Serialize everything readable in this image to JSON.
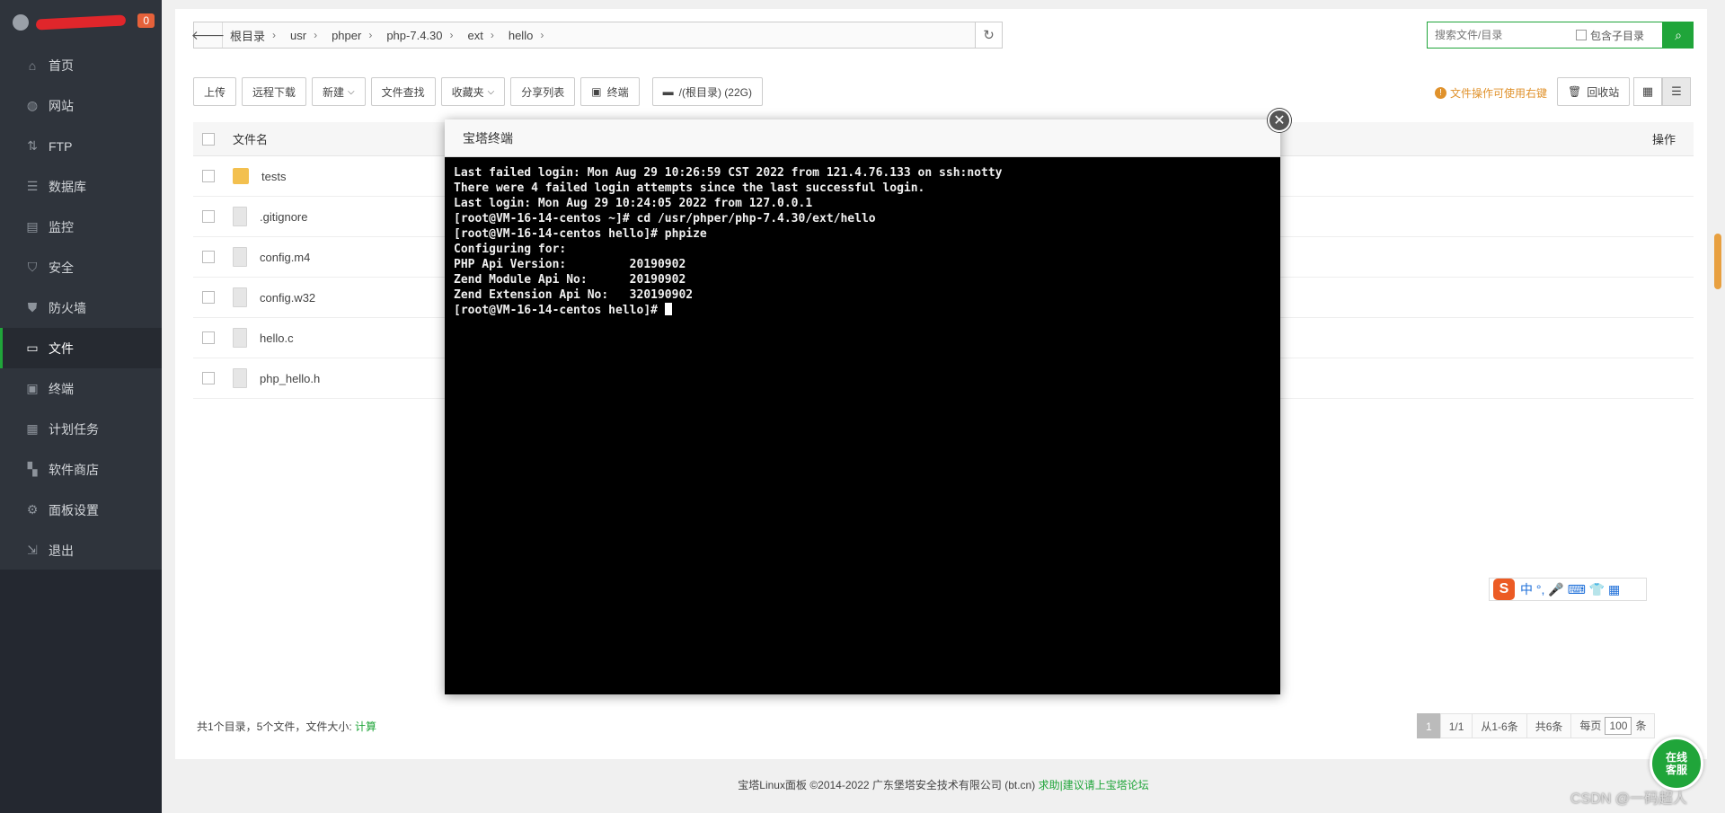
{
  "sidebar": {
    "badge": "0",
    "items": [
      {
        "label": "首页",
        "icon": "home-icon"
      },
      {
        "label": "网站",
        "icon": "globe-icon"
      },
      {
        "label": "FTP",
        "icon": "ftp-icon"
      },
      {
        "label": "数据库",
        "icon": "database-icon"
      },
      {
        "label": "监控",
        "icon": "monitor-icon"
      },
      {
        "label": "安全",
        "icon": "shield-icon"
      },
      {
        "label": "防火墙",
        "icon": "firewall-icon"
      },
      {
        "label": "文件",
        "icon": "folder-icon"
      },
      {
        "label": "终端",
        "icon": "terminal-icon"
      },
      {
        "label": "计划任务",
        "icon": "calendar-icon"
      },
      {
        "label": "软件商店",
        "icon": "apps-icon"
      },
      {
        "label": "面板设置",
        "icon": "gear-icon"
      },
      {
        "label": "退出",
        "icon": "logout-icon"
      }
    ],
    "active_index": 7
  },
  "path": {
    "crumbs": [
      "根目录",
      "usr",
      "phper",
      "php-7.4.30",
      "ext",
      "hello"
    ]
  },
  "search": {
    "placeholder": "搜索文件/目录",
    "include_subdir": "包含子目录"
  },
  "toolbar": {
    "upload": "上传",
    "remote_download": "远程下载",
    "new": "新建",
    "file_search": "文件查找",
    "favorites": "收藏夹",
    "share_list": "分享列表",
    "terminal": "终端",
    "disk": "/(根目录) (22G)"
  },
  "tip": "文件操作可使用右键",
  "recycle": "回收站",
  "table": {
    "col_name": "文件名",
    "col_op": "操作",
    "rows": [
      {
        "name": "tests",
        "type": "folder"
      },
      {
        "name": ".gitignore",
        "type": "file"
      },
      {
        "name": "config.m4",
        "type": "file"
      },
      {
        "name": "config.w32",
        "type": "file"
      },
      {
        "name": "hello.c",
        "type": "file"
      },
      {
        "name": "php_hello.h",
        "type": "file"
      }
    ]
  },
  "summary": {
    "text": "共1个目录，5个文件，文件大小:",
    "link": "计算"
  },
  "pager": {
    "current": "1",
    "pages": "1/1",
    "range": "从1-6条",
    "total": "共6条",
    "per_page_label": "每页",
    "per_page": "100",
    "unit": "条"
  },
  "footer": {
    "text": "宝塔Linux面板 ©2014-2022 广东堡塔安全技术有限公司 (bt.cn)",
    "link": "求助|建议请上宝塔论坛"
  },
  "modal": {
    "title": "宝塔终端",
    "lines": [
      "Last failed login: Mon Aug 29 10:26:59 CST 2022 from 121.4.76.133 on ssh:notty",
      "There were 4 failed login attempts since the last successful login.",
      "Last login: Mon Aug 29 10:24:05 2022 from 127.0.0.1",
      "[root@VM-16-14-centos ~]# cd /usr/phper/php-7.4.30/ext/hello",
      "[root@VM-16-14-centos hello]# phpize",
      "Configuring for:",
      "PHP Api Version:         20190902",
      "Zend Module Api No:      20190902",
      "Zend Extension Api No:   320190902"
    ],
    "prompt": "[root@VM-16-14-centos hello]# "
  },
  "ime": {
    "text": "中 °, 🎤 ⌨ 👕 ▦"
  },
  "chat": {
    "line1": "在线",
    "line2": "客服"
  },
  "watermark": "CSDN @一码超人"
}
